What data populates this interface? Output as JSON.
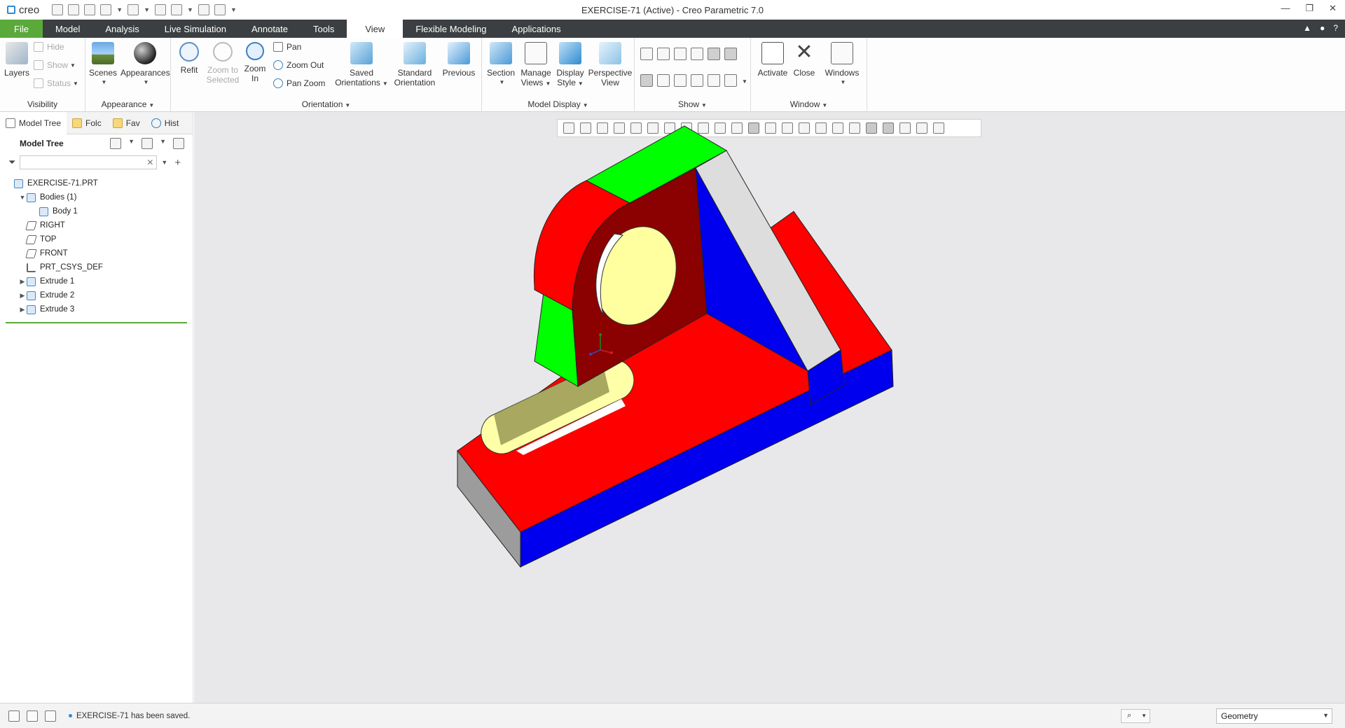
{
  "app": {
    "logo_text": "creo",
    "window_title": "EXERCISE-71 (Active) - Creo Parametric 7.0"
  },
  "window_controls": [
    "—",
    "❐",
    "✕"
  ],
  "tabs": [
    {
      "label": "File"
    },
    {
      "label": "Model"
    },
    {
      "label": "Analysis"
    },
    {
      "label": "Live Simulation"
    },
    {
      "label": "Annotate"
    },
    {
      "label": "Tools"
    },
    {
      "label": "View",
      "active": true
    },
    {
      "label": "Flexible Modeling"
    },
    {
      "label": "Applications"
    }
  ],
  "ribbon": {
    "visibility": {
      "label": "Visibility",
      "layers": "Layers",
      "hide": "Hide",
      "show": "Show",
      "status": "Status"
    },
    "appearance": {
      "label": "Appearance",
      "scenes": "Scenes",
      "appearances": "Appearances"
    },
    "orientation": {
      "label": "Orientation",
      "refit": "Refit",
      "zoom_to_selected_1": "Zoom to",
      "zoom_to_selected_2": "Selected",
      "zoom_in_1": "Zoom",
      "zoom_in_2": "In",
      "pan": "Pan",
      "zoom_out": "Zoom Out",
      "pan_zoom": "Pan Zoom",
      "saved_1": "Saved",
      "saved_2": "Orientations",
      "standard_1": "Standard",
      "standard_2": "Orientation",
      "previous": "Previous"
    },
    "model_display": {
      "label": "Model Display",
      "section": "Section",
      "manage_1": "Manage",
      "manage_2": "Views",
      "display_1": "Display",
      "display_2": "Style",
      "perspective_1": "Perspective",
      "perspective_2": "View"
    },
    "show": {
      "label": "Show"
    },
    "window": {
      "label": "Window",
      "activate": "Activate",
      "close": "Close",
      "windows": "Windows"
    }
  },
  "panel": {
    "tabs": [
      {
        "label": "Model Tree"
      },
      {
        "label": "Folc"
      },
      {
        "label": "Fav"
      },
      {
        "label": "Hist"
      }
    ],
    "tree_header": "Model Tree",
    "search_placeholder": "",
    "tree": [
      {
        "label": "EXERCISE-71.PRT",
        "indent": 0,
        "expander": "",
        "icon": "part-icon"
      },
      {
        "label": "Bodies (1)",
        "indent": 1,
        "expander": "▼",
        "icon": "bodies-icon"
      },
      {
        "label": "Body 1",
        "indent": 2,
        "expander": "",
        "icon": "body-icon"
      },
      {
        "label": "RIGHT",
        "indent": 1,
        "expander": "",
        "icon": "datum-plane-icon"
      },
      {
        "label": "TOP",
        "indent": 1,
        "expander": "",
        "icon": "datum-plane-icon"
      },
      {
        "label": "FRONT",
        "indent": 1,
        "expander": "",
        "icon": "datum-plane-icon"
      },
      {
        "label": "PRT_CSYS_DEF",
        "indent": 1,
        "expander": "",
        "icon": "csys-icon"
      },
      {
        "label": "Extrude 1",
        "indent": 1,
        "expander": "▶",
        "icon": "extrude-icon"
      },
      {
        "label": "Extrude 2",
        "indent": 1,
        "expander": "▶",
        "icon": "extrude-icon"
      },
      {
        "label": "Extrude 3",
        "indent": 1,
        "expander": "▶",
        "icon": "extrude-icon"
      }
    ]
  },
  "status": {
    "message": "EXERCISE-71 has been saved.",
    "selection_filter": "Geometry"
  },
  "colors": {
    "face_red": "#ff0000",
    "face_green": "#00ff00",
    "face_blue": "#0000ee",
    "face_dark_red": "#8b0000",
    "face_gray": "#dcdcdc",
    "hole_yellow": "#ffffa0",
    "background": "#e8e8ea"
  }
}
